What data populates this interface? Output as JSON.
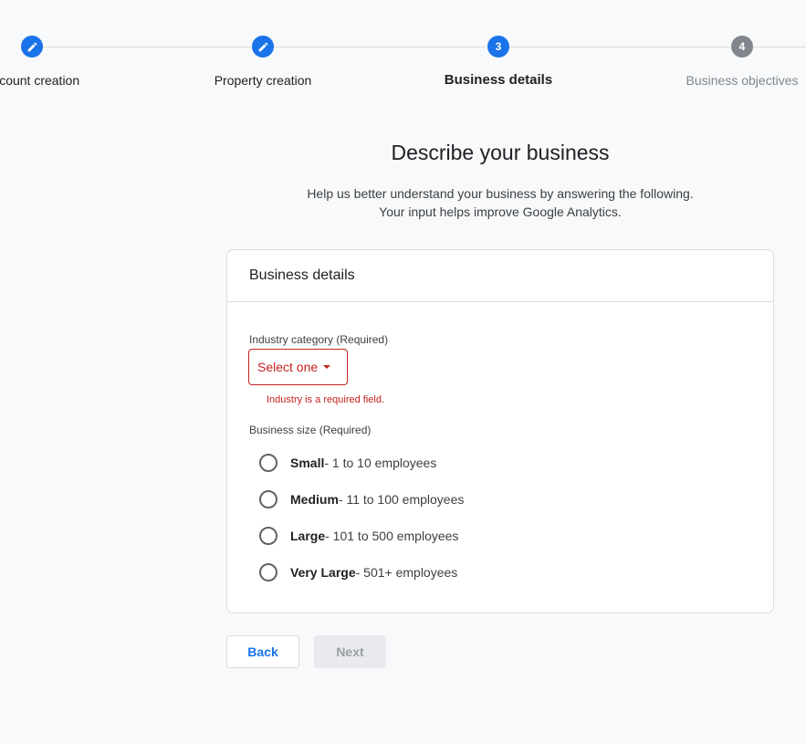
{
  "stepper": {
    "steps": [
      {
        "label": "Account creation",
        "state": "done",
        "icon": "pencil-icon"
      },
      {
        "label": "Property creation",
        "state": "done",
        "icon": "pencil-icon"
      },
      {
        "label": "Business details",
        "state": "active",
        "number": "3"
      },
      {
        "label": "Business objectives",
        "state": "pending",
        "number": "4"
      }
    ]
  },
  "page": {
    "heading": "Describe your business",
    "subtext_line1": "Help us better understand your business by answering the following.",
    "subtext_line2": "Your input helps improve Google Analytics."
  },
  "card": {
    "title": "Business details",
    "industry": {
      "label": "Industry category (Required)",
      "selected": "Select one",
      "error": "Industry is a required field."
    },
    "size": {
      "label": "Business size (Required)",
      "options": [
        {
          "name": "Small",
          "desc": " - 1 to 10 employees"
        },
        {
          "name": "Medium",
          "desc": " - 11 to 100 employees"
        },
        {
          "name": "Large",
          "desc": " - 101 to 500 employees"
        },
        {
          "name": "Very Large",
          "desc": " - 501+ employees"
        }
      ]
    }
  },
  "actions": {
    "back": "Back",
    "next": "Next"
  },
  "colors": {
    "primary": "#1a73e8",
    "error": "#c5221f",
    "pending": "#80868b"
  }
}
